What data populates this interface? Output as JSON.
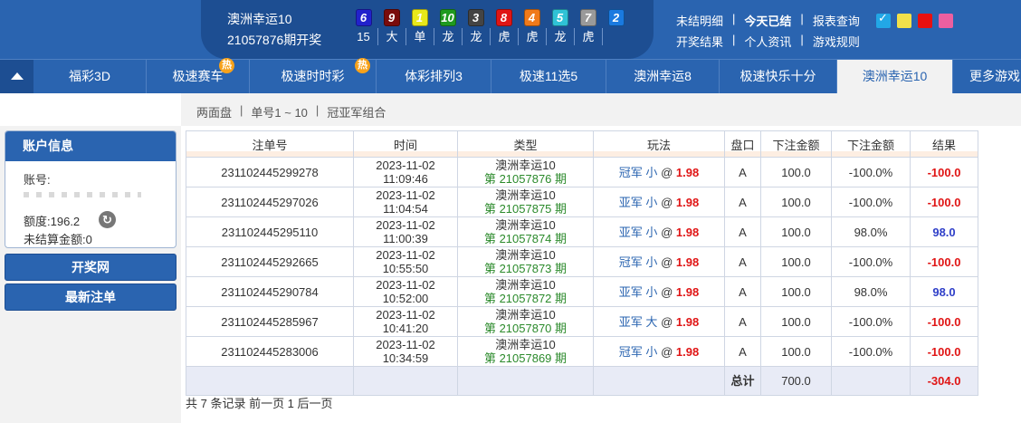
{
  "header": {
    "lottery_name": "澳洲幸运10",
    "issue_text": "21057876期开奖",
    "balls": [
      {
        "num": "6",
        "color": "#2222cc",
        "label": "15"
      },
      {
        "num": "9",
        "color": "#7a0c0c",
        "label": "大"
      },
      {
        "num": "1",
        "color": "#e8e81a",
        "label": "单"
      },
      {
        "num": "10",
        "color": "#1f9a1f",
        "label": "龙"
      },
      {
        "num": "3",
        "color": "#444444",
        "label": "龙"
      },
      {
        "num": "8",
        "color": "#e01515",
        "label": "虎"
      },
      {
        "num": "4",
        "color": "#f07a1a",
        "label": "虎"
      },
      {
        "num": "5",
        "color": "#2fc2d6",
        "label": "龙"
      },
      {
        "num": "7",
        "color": "#9a9a9a",
        "label": "虎"
      },
      {
        "num": "2",
        "color": "#1a7ae0",
        "label": ""
      }
    ],
    "links_row1": [
      "未结明细",
      "今天已结",
      "报表查询"
    ],
    "links_row2": [
      "开奖结果",
      "个人资讯",
      "游戏规则"
    ],
    "swatch_check": "✓",
    "swatch_colors": [
      "#22a7e6",
      "#f2e04a",
      "#e81010",
      "#ec5fa0"
    ]
  },
  "nav": {
    "items": [
      "福彩3D",
      "极速赛车",
      "极速时时彩",
      "体彩排列3",
      "极速11选5",
      "澳洲幸运8",
      "极速快乐十分",
      "澳洲幸运10",
      "更多游戏"
    ],
    "hot_label": "热"
  },
  "subnav": {
    "items": [
      "两面盘",
      "单号1 ~ 10",
      "冠亚军组合"
    ]
  },
  "sidebar": {
    "account_title": "账户信息",
    "account_label": "账号:",
    "credit_label": "额度:",
    "credit_value": "196.2",
    "unsettled_label": "未结算金额:",
    "unsettled_value": "0",
    "btn_draw": "开奖网",
    "btn_latest": "最新注单"
  },
  "table": {
    "headers": [
      "注单号",
      "时间",
      "类型",
      "玩法",
      "盘口",
      "下注金额",
      "下注金额",
      "结果"
    ],
    "rows": [
      {
        "id": "231102445299278",
        "date": "2023-11-02",
        "time": "11:09:46",
        "game": "澳洲幸运10",
        "issue": "第 21057876 期",
        "pos": "冠军",
        "bet": "小",
        "at": "@",
        "odds": "1.98",
        "pan": "A",
        "amount": "100.0",
        "pct": "-100.0%",
        "result": "-100.0"
      },
      {
        "id": "231102445297026",
        "date": "2023-11-02",
        "time": "11:04:54",
        "game": "澳洲幸运10",
        "issue": "第 21057875 期",
        "pos": "亚军",
        "bet": "小",
        "at": "@",
        "odds": "1.98",
        "pan": "A",
        "amount": "100.0",
        "pct": "-100.0%",
        "result": "-100.0"
      },
      {
        "id": "231102445295110",
        "date": "2023-11-02",
        "time": "11:00:39",
        "game": "澳洲幸运10",
        "issue": "第 21057874 期",
        "pos": "亚军",
        "bet": "小",
        "at": "@",
        "odds": "1.98",
        "pan": "A",
        "amount": "100.0",
        "pct": "98.0%",
        "result": "98.0"
      },
      {
        "id": "231102445292665",
        "date": "2023-11-02",
        "time": "10:55:50",
        "game": "澳洲幸运10",
        "issue": "第 21057873 期",
        "pos": "冠军",
        "bet": "小",
        "at": "@",
        "odds": "1.98",
        "pan": "A",
        "amount": "100.0",
        "pct": "-100.0%",
        "result": "-100.0"
      },
      {
        "id": "231102445290784",
        "date": "2023-11-02",
        "time": "10:52:00",
        "game": "澳洲幸运10",
        "issue": "第 21057872 期",
        "pos": "亚军",
        "bet": "小",
        "at": "@",
        "odds": "1.98",
        "pan": "A",
        "amount": "100.0",
        "pct": "98.0%",
        "result": "98.0"
      },
      {
        "id": "231102445285967",
        "date": "2023-11-02",
        "time": "10:41:20",
        "game": "澳洲幸运10",
        "issue": "第 21057870 期",
        "pos": "亚军",
        "bet": "大",
        "at": "@",
        "odds": "1.98",
        "pan": "A",
        "amount": "100.0",
        "pct": "-100.0%",
        "result": "-100.0"
      },
      {
        "id": "231102445283006",
        "date": "2023-11-02",
        "time": "10:34:59",
        "game": "澳洲幸运10",
        "issue": "第 21057869 期",
        "pos": "冠军",
        "bet": "小",
        "at": "@",
        "odds": "1.98",
        "pan": "A",
        "amount": "100.0",
        "pct": "-100.0%",
        "result": "-100.0"
      }
    ],
    "total_label": "总计",
    "total_amount": "700.0",
    "total_result": "-304.0"
  },
  "footer": {
    "text": "共 7 条记录 前一页 1 后一页"
  }
}
